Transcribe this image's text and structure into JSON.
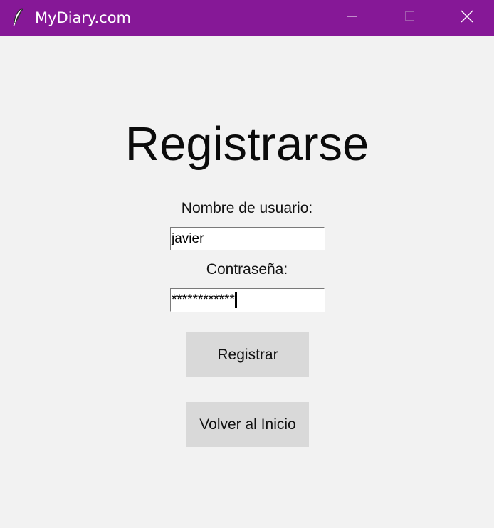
{
  "window": {
    "title": "MyDiary.com",
    "app_icon": "feather-icon",
    "controls": {
      "minimize_icon": "minimize-icon",
      "maximize_icon": "maximize-icon",
      "close_icon": "close-icon"
    },
    "titlebar_color": "#861897"
  },
  "form": {
    "heading": "Registrarse",
    "username_label": "Nombre de usuario:",
    "username_value": "javier",
    "password_label": "Contraseña:",
    "password_value": "************",
    "register_button": "Registrar",
    "back_button": "Volver al Inicio"
  }
}
